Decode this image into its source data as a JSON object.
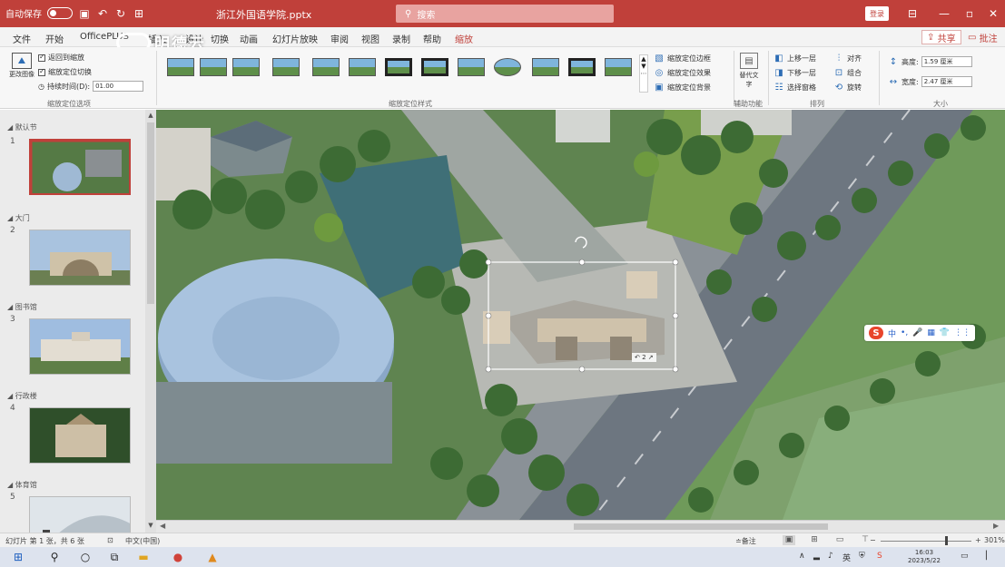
{
  "titlebar": {
    "autosave_label": "自动保存",
    "autosave_state": "关",
    "doc_title": "浙江外国语学院.pptx",
    "search_placeholder": "搜索",
    "user_chip": "登录",
    "icons": [
      "save-icon",
      "undo-icon",
      "redo-icon",
      "present-icon"
    ]
  },
  "tabs": [
    "文件",
    "开始",
    "OfficePLUS",
    "插入",
    "设计",
    "切换",
    "动画",
    "幻灯片放映",
    "审阅",
    "视图",
    "录制",
    "帮助",
    "缩放"
  ],
  "active_tab": "缩放",
  "share_label": "共享",
  "comment_label": "批注",
  "logo": {
    "text": "明德云"
  },
  "ribbon": {
    "group1": {
      "label": "缩放定位选项",
      "btn_label": "更改图像",
      "opt1": "返回到缩放",
      "opt2": "缩放定位切换",
      "duration_label": "持续时间(D):",
      "duration_value": "01.00"
    },
    "group2": {
      "label": "缩放定位样式",
      "right_items": [
        "缩放定位边框",
        "缩放定位效果",
        "缩放定位背景"
      ]
    },
    "group3": {
      "label": "辅助功能",
      "btn": "替代文字"
    },
    "group4": {
      "label": "排列",
      "items": [
        "上移一层",
        "对齐",
        "下移一层",
        "组合",
        "选择窗格",
        "旋转"
      ]
    },
    "group5": {
      "label": "大小",
      "height_label": "高度:",
      "height_value": "1.59 厘米",
      "width_label": "宽度:",
      "width_value": "2.47 厘米"
    }
  },
  "slides": [
    {
      "section": "默认节",
      "num": "1",
      "selected": true
    },
    {
      "section": "大门",
      "num": "2",
      "selected": false
    },
    {
      "section": "图书馆",
      "num": "3",
      "selected": false
    },
    {
      "section": "行政楼",
      "num": "4",
      "selected": false
    },
    {
      "section": "体育馆",
      "num": "5",
      "selected": false
    }
  ],
  "canvas": {
    "object_label": "↶ 2 ↗"
  },
  "ime": {
    "logo": "S",
    "items": [
      "中",
      "•,",
      "🎤",
      "▦",
      "👕",
      "⋮⋮"
    ]
  },
  "status": {
    "slide_info": "幻灯片 第 1 张，共 6 张",
    "lang": "中文(中国)",
    "notes": "备注",
    "zoom_pct": "301%"
  },
  "taskbar": {
    "time": "16:03",
    "date": "2023/5/22"
  }
}
